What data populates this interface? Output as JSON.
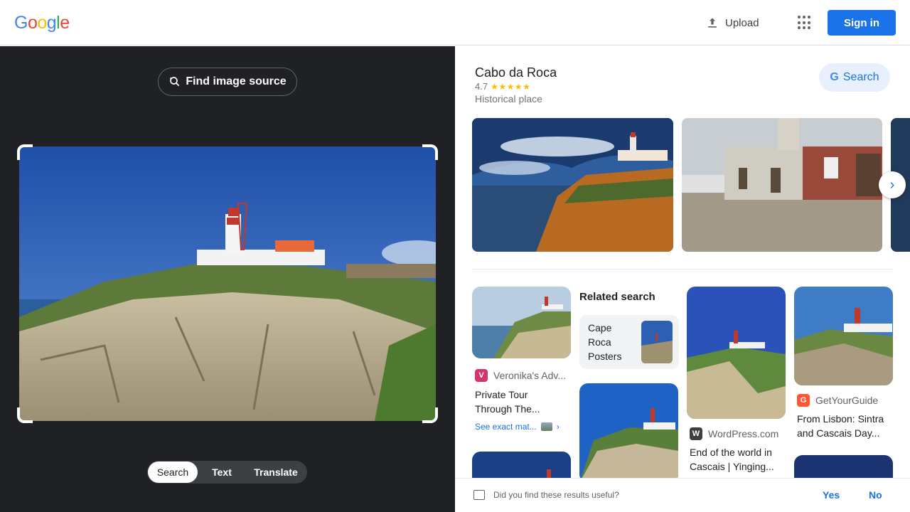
{
  "header": {
    "logo": [
      "G",
      "o",
      "o",
      "g",
      "l",
      "e"
    ],
    "logo_colors": [
      "#4285f4",
      "#ea4335",
      "#fbbc05",
      "#4285f4",
      "#34a853",
      "#ea4335"
    ],
    "upload_label": "Upload",
    "signin_label": "Sign in"
  },
  "left_panel": {
    "find_source_label": "Find image source",
    "modes": [
      "Search",
      "Text",
      "Translate"
    ],
    "active_mode": "Search"
  },
  "knowledge_panel": {
    "title": "Cabo da Roca",
    "rating": "4.7",
    "stars": "★★★★★",
    "type": "Historical place",
    "search_label": "Search"
  },
  "results": {
    "card1": {
      "source": "Veronika's Adv...",
      "title_line1": "Private Tour",
      "title_line2": "Through The...",
      "exact_label": "See exact mat..."
    },
    "related": {
      "heading": "Related search",
      "item_line1": "Cape",
      "item_line2": "Roca",
      "item_line3": "Posters"
    },
    "card3": {
      "source": "WordPress.com",
      "title_line1": "End of the world in",
      "title_line2": "Cascais  | Yinging..."
    },
    "card4": {
      "source": "GetYourGuide",
      "title_line1": "From Lisbon: Sintra",
      "title_line2": "and Cascais Day..."
    }
  },
  "feedback": {
    "question": "Did you find these results useful?",
    "yes": "Yes",
    "no": "No"
  },
  "colors": {
    "accent": "#1a73e8",
    "dark_panel": "#202124"
  }
}
